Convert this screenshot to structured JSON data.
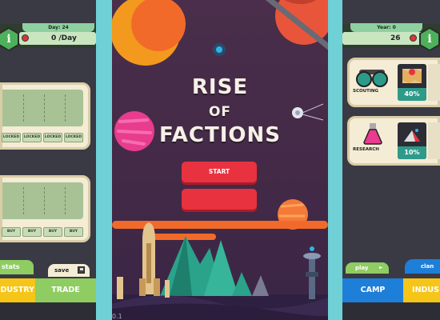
{
  "left_panel": {
    "day_label": "Day: 24",
    "rate_text": "0 /Day",
    "chip_row_1": [
      "LOCKED",
      "LOCKED",
      "LOCKED",
      "LOCKED"
    ],
    "chip_row_2": [
      "BUY",
      "BUY",
      "BUY",
      "BUY"
    ],
    "tab_stats": "stats",
    "tab_save": "save",
    "btn_industry": "INDUSTRY",
    "btn_trade": "TRADE",
    "info_glyph": "i"
  },
  "center": {
    "title_line1": "RISE",
    "title_line2": "OF",
    "title_line3": "FACTIONS",
    "start_label": "START",
    "second_button_label": "",
    "version": "0.1"
  },
  "right_panel": {
    "year_label": "Year: 0",
    "count_text": "26",
    "info_glyph": "i",
    "cards": [
      {
        "label": "SCOUTING",
        "percent": "40%",
        "icon": "binoculars-icon",
        "thumb": "map-icon"
      },
      {
        "label": "RESEARCH",
        "percent": "10%",
        "icon": "flask-icon",
        "thumb": "lab-icon"
      }
    ],
    "tab_play": "play",
    "tab_clan": "clan",
    "btn_camp": "CAMP",
    "btn_industry": "INDUS"
  },
  "colors": {
    "background": "#6fd0d6",
    "accent_red": "#e8323f",
    "green": "#8fcc62",
    "blue": "#1e7fd8",
    "yellow": "#f5c518",
    "teal": "#2e9a8a"
  }
}
